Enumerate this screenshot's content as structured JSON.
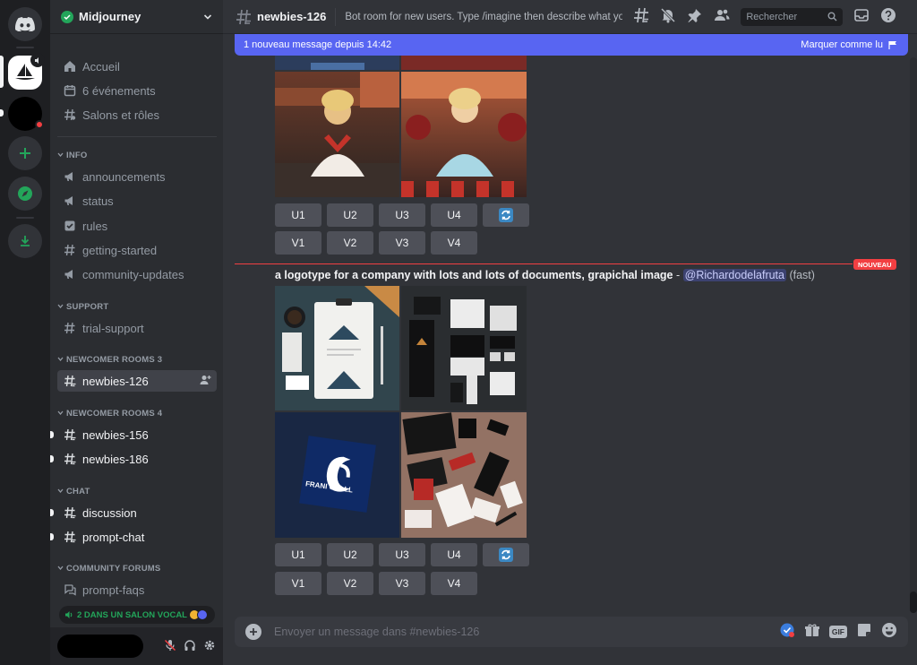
{
  "server": {
    "name": "Midjourney"
  },
  "sidebar": {
    "top_items": [
      {
        "label": "Accueil",
        "icon": "home-icon"
      },
      {
        "label": "6 événements",
        "icon": "calendar-icon"
      },
      {
        "label": "Salons et rôles",
        "icon": "channels-roles-icon"
      }
    ],
    "categories": [
      {
        "label": "INFO"
      },
      {
        "label": "SUPPORT"
      },
      {
        "label": "NEWCOMER ROOMS 3"
      },
      {
        "label": "NEWCOMER ROOMS 4"
      },
      {
        "label": "CHAT"
      },
      {
        "label": "COMMUNITY FORUMS"
      }
    ],
    "channels": [
      {
        "label": "announcements",
        "icon": "megaphone-icon"
      },
      {
        "label": "status",
        "icon": "megaphone-icon"
      },
      {
        "label": "rules",
        "icon": "checkbox-icon"
      },
      {
        "label": "getting-started",
        "icon": "hash-icon"
      },
      {
        "label": "community-updates",
        "icon": "megaphone-icon"
      },
      {
        "label": "trial-support",
        "icon": "hash-icon"
      },
      {
        "label": "newbies-126",
        "icon": "hash-threads-icon"
      },
      {
        "label": "newbies-156",
        "icon": "hash-threads-icon"
      },
      {
        "label": "newbies-186",
        "icon": "hash-threads-icon"
      },
      {
        "label": "discussion",
        "icon": "hash-threads-icon"
      },
      {
        "label": "prompt-chat",
        "icon": "hash-threads-icon"
      },
      {
        "label": "prompt-faqs",
        "icon": "forum-icon"
      }
    ],
    "voice_indicator": "2 DANS UN SALON VOCAL"
  },
  "header": {
    "channel": "newbies-126",
    "topic": "Bot room for new users. Type /imagine then describe what you ...",
    "search_placeholder": "Rechercher"
  },
  "new_messages_bar": {
    "text": "1 nouveau message depuis 14:42",
    "action": "Marquer comme lu"
  },
  "first_result": {
    "upscale_buttons": [
      "U1",
      "U2",
      "U3",
      "U4"
    ],
    "variation_buttons": [
      "V1",
      "V2",
      "V3",
      "V4"
    ]
  },
  "new_divider": "NOUVEAU",
  "message": {
    "prompt": "a logotype for a company with lots and lots of documents, grapichal image",
    "separator": " - ",
    "mention": "@Richardodelafruta",
    "mode": "(fast)",
    "logo_text": "FRANI GALLL",
    "upscale_buttons": [
      "U1",
      "U2",
      "U3",
      "U4"
    ],
    "variation_buttons": [
      "V1",
      "V2",
      "V3",
      "V4"
    ]
  },
  "composer": {
    "placeholder": "Envoyer un message dans #newbies-126"
  },
  "colors": {
    "accent": "#5865f2",
    "online": "#23a55a",
    "danger": "#f23f42"
  }
}
